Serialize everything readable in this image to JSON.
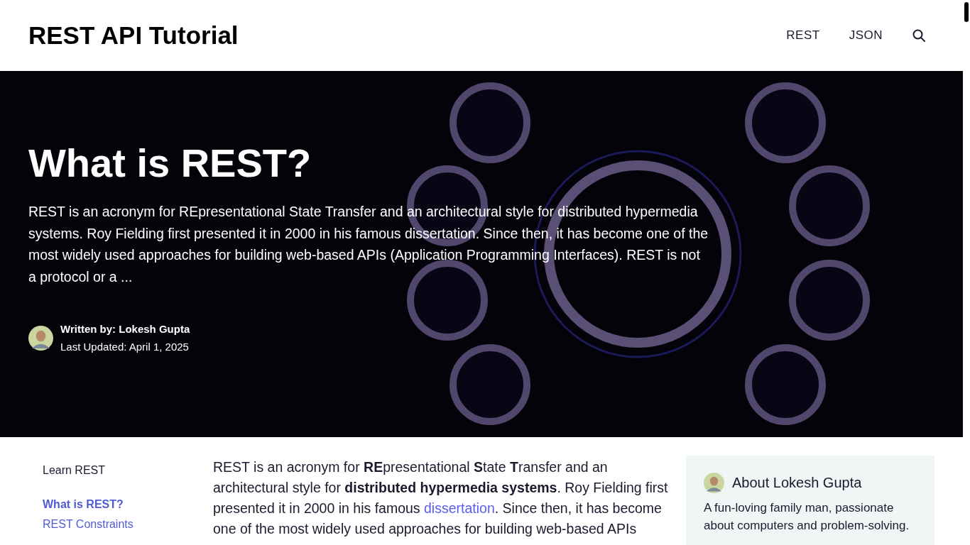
{
  "site_title": "REST API Tutorial",
  "nav": [
    {
      "label": "REST"
    },
    {
      "label": "JSON"
    }
  ],
  "hero": {
    "title": "What is REST?",
    "excerpt": "REST is an acronym for REpresentational State Transfer and an architectural style for distributed hypermedia systems. Roy Fielding first presented it in 2000 in his famous dissertation. Since then, it has become one of the most widely used approaches for building web-based APIs (Application Programming Interfaces). REST is not a protocol or a ...",
    "author": "Written by: Lokesh Gupta",
    "updated": "Last Updated: April 1, 2025"
  },
  "sidebar": {
    "heading": "Learn REST",
    "items": [
      {
        "label": "What is REST?",
        "selected": true
      },
      {
        "label": "REST Constraints",
        "selected": false
      }
    ]
  },
  "article": {
    "before": "REST is an acronym for **RE**presentational **S**tate **T**ransfer and an architectural style for **distributed hypermedia systems**. Roy Fielding first presented it in 2000 in his famous ",
    "link": "dissertation",
    "after": ". Since then, it has become one of the most widely used approaches for building web-based APIs"
  },
  "about": {
    "title": "About Lokesh Gupta",
    "text": "A fun-loving family man, passionate about computers and problem-solving."
  }
}
